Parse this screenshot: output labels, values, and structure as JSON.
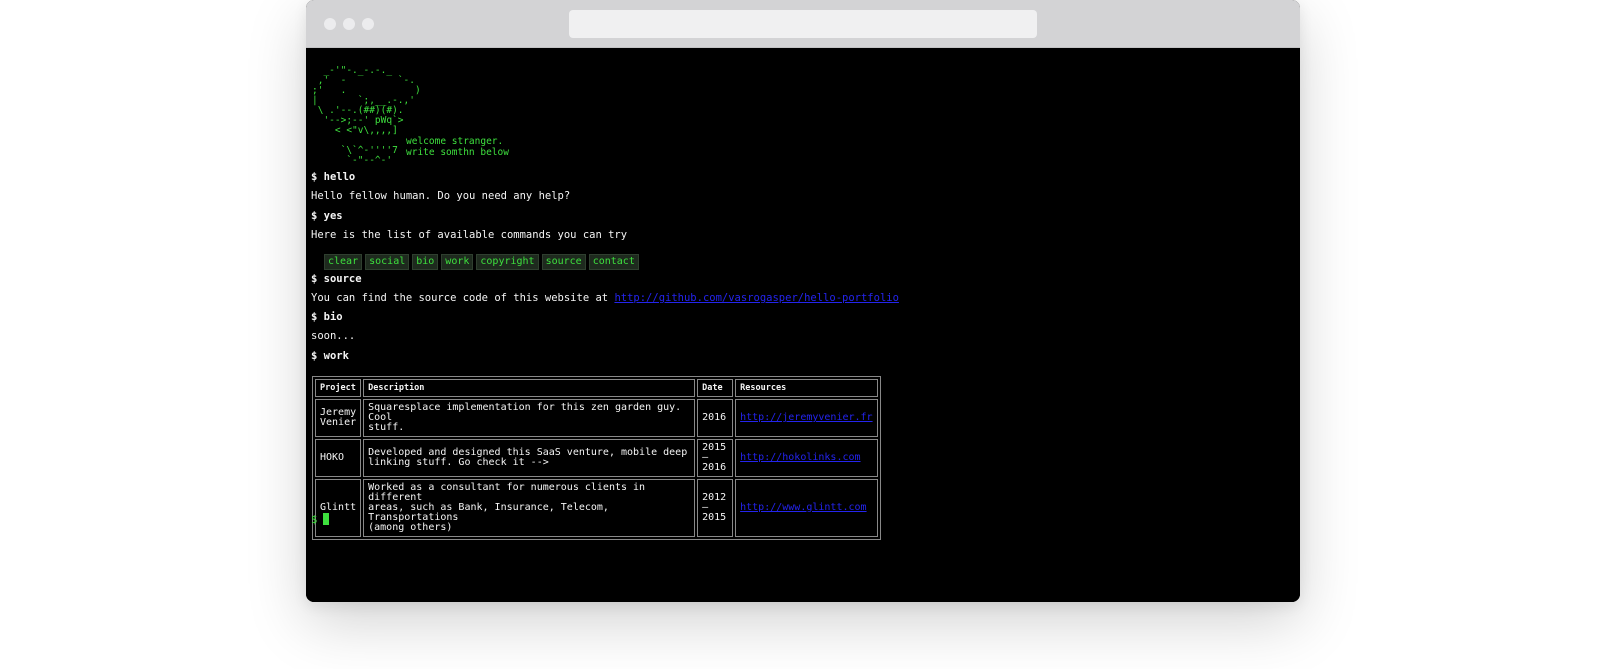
{
  "terminal": {
    "ascii_art": "  _-'\"-._-.-._\n ,'  -         `-.\n;'   .            )\n|       `;,__.-.,'\n \\ .'--.(##)(#).\n  '-->;--' pWq`>\n    < <\"v\\,,,,]\n\n     `\\`^-''''7\n      `-\"--^-'",
    "welcome_line1": "welcome stranger.",
    "welcome_line2": "write somthn below",
    "cmd_hello": "$ hello",
    "resp_hello": "Hello fellow human. Do you need any help?",
    "cmd_yes": "$ yes",
    "resp_yes": "Here is the list of available commands you can try",
    "commands": [
      "clear",
      "social",
      "bio",
      "work",
      "copyright",
      "source",
      "contact"
    ],
    "cmd_source": "$ source",
    "resp_source_prefix": "You can find the source code of this website at ",
    "source_link": "http://github.com/vasrogasper/hello-portfolio",
    "cmd_bio": "$ bio",
    "resp_bio": "soon...",
    "cmd_work": "$ work",
    "prompt_symbol": "$"
  },
  "work_table": {
    "headers": [
      "Project",
      "Description",
      "Date",
      "Resources"
    ],
    "rows": [
      {
        "project_l1": "Jeremy",
        "project_l2": "Venier",
        "desc_l1": "Squaresplace implementation for this zen garden guy. Cool",
        "desc_l2": "stuff.",
        "date_l1": "2016",
        "date_l2": "",
        "date_l3": "",
        "link": "http://jeremyvenier.fr"
      },
      {
        "project_l1": "HOKO",
        "project_l2": "",
        "desc_l1": "Developed and designed this SaaS venture, mobile deep",
        "desc_l2": "linking stuff. Go check it -->",
        "date_l1": "2015",
        "date_l2": "–",
        "date_l3": "2016",
        "link": "http://hokolinks.com"
      },
      {
        "project_l1": "Glintt",
        "project_l2": "",
        "desc_l1": "Worked as a consultant for numerous clients in different",
        "desc_l2": "areas, such as Bank, Insurance, Telecom, Transportations",
        "desc_l3": "(among others)",
        "date_l1": "2012",
        "date_l2": "–",
        "date_l3": "2015",
        "link": "http://www.glintt.com"
      }
    ]
  },
  "colors": {
    "terminal_green": "#3ee03e",
    "link_blue": "#2424ee",
    "background": "#000000"
  }
}
